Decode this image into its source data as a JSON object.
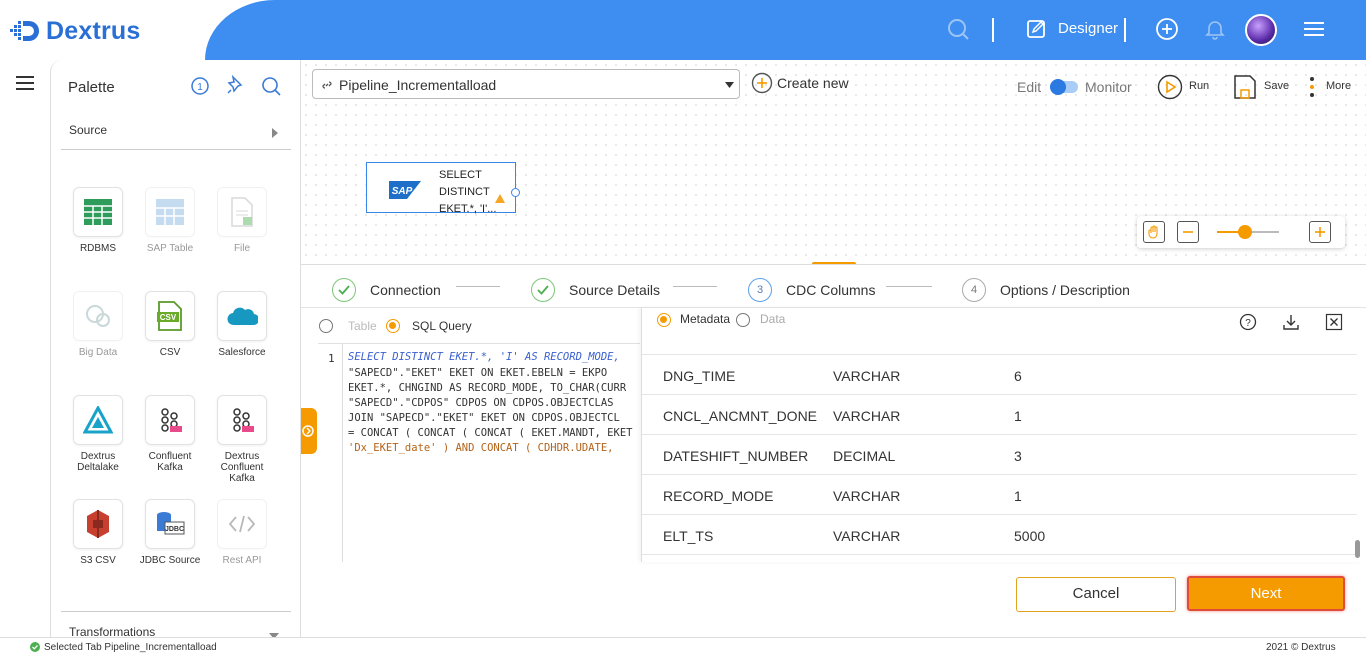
{
  "app": {
    "name": "Dextrus",
    "brand_color": "#3d8ef0"
  },
  "header": {
    "designer_label": "Designer"
  },
  "palette": {
    "title": "Palette",
    "source_section": "Source",
    "transformations_section": "Transformations",
    "items": [
      {
        "label": "RDBMS",
        "icon": "table-grid-icon",
        "enabled": true
      },
      {
        "label": "SAP Table",
        "icon": "sap-table-icon",
        "enabled": false
      },
      {
        "label": "File",
        "icon": "file-icon",
        "enabled": false
      },
      {
        "label": "Big Data",
        "icon": "big-data-icon",
        "enabled": false
      },
      {
        "label": "CSV",
        "icon": "csv-icon",
        "enabled": true
      },
      {
        "label": "Salesforce",
        "icon": "salesforce-cloud-icon",
        "enabled": true
      },
      {
        "label": "Dextrus Deltalake",
        "icon": "deltalake-icon",
        "enabled": true
      },
      {
        "label": "Confluent Kafka",
        "icon": "kafka-icon",
        "enabled": true
      },
      {
        "label": "Dextrus Confluent Kafka",
        "icon": "kafka-icon",
        "enabled": true
      },
      {
        "label": "S3 CSV",
        "icon": "s3-icon",
        "enabled": true
      },
      {
        "label": "JDBC Source",
        "icon": "jdbc-icon",
        "enabled": true
      },
      {
        "label": "Rest API",
        "icon": "code-brackets-icon",
        "enabled": false
      }
    ]
  },
  "toolbar": {
    "pipeline_name": "Pipeline_Incrementalload",
    "create_new": "Create new",
    "mode_edit": "Edit",
    "mode_monitor": "Monitor",
    "run": "Run",
    "save": "Save",
    "more": "More"
  },
  "node": {
    "text_lines": [
      "SELECT",
      "DISTINCT",
      "EKET.*, 'I'..."
    ],
    "badge": "SAP"
  },
  "steps": [
    {
      "label": "Connection",
      "state": "done",
      "num": "1"
    },
    {
      "label": "Source Details",
      "state": "done",
      "num": "2"
    },
    {
      "label": "CDC Columns",
      "state": "active",
      "num": "3"
    },
    {
      "label": "Options / Description",
      "state": "pending",
      "num": "4"
    }
  ],
  "query_panel": {
    "table_option": "Table",
    "sql_option": "SQL Query",
    "selected": "SQL Query",
    "line_number": "1",
    "code_lines": [
      "SELECT DISTINCT EKET.*,  'I' AS RECORD_MODE,",
      "\"SAPECD\".\"EKET\" EKET    ON EKET.EBELN = EKPO",
      "EKET.*,  CHNGIND AS RECORD_MODE, TO_CHAR(CURR",
      "\"SAPECD\".\"CDPOS\" CDPOS   ON CDPOS.OBJECTCLAS",
      "JOIN \"SAPECD\".\"EKET\" EKET   ON CDPOS.OBJECTCL",
      "= CONCAT ( CONCAT ( CONCAT ( EKET.MANDT, EKET",
      "'Dx_EKET_date' )   AND CONCAT ( CDHDR.UDATE,"
    ]
  },
  "metadata_panel": {
    "metadata_option": "Metadata",
    "data_option": "Data",
    "selected": "Metadata",
    "rows": [
      {
        "name": "DNG_TIME",
        "type": "VARCHAR",
        "size": "6"
      },
      {
        "name": "CNCL_ANCMNT_DONE",
        "type": "VARCHAR",
        "size": "1"
      },
      {
        "name": "DATESHIFT_NUMBER",
        "type": "DECIMAL",
        "size": "3"
      },
      {
        "name": "RECORD_MODE",
        "type": "VARCHAR",
        "size": "1"
      },
      {
        "name": "ELT_TS",
        "type": "VARCHAR",
        "size": "5000"
      }
    ]
  },
  "buttons": {
    "cancel": "Cancel",
    "next": "Next"
  },
  "status": {
    "message": "Selected Tab Pipeline_Incrementalload",
    "copyright": "2021 © Dextrus"
  },
  "colors": {
    "accent_orange": "#f59b00",
    "next_border": "#e14b3a",
    "success_green": "#4caf50"
  }
}
